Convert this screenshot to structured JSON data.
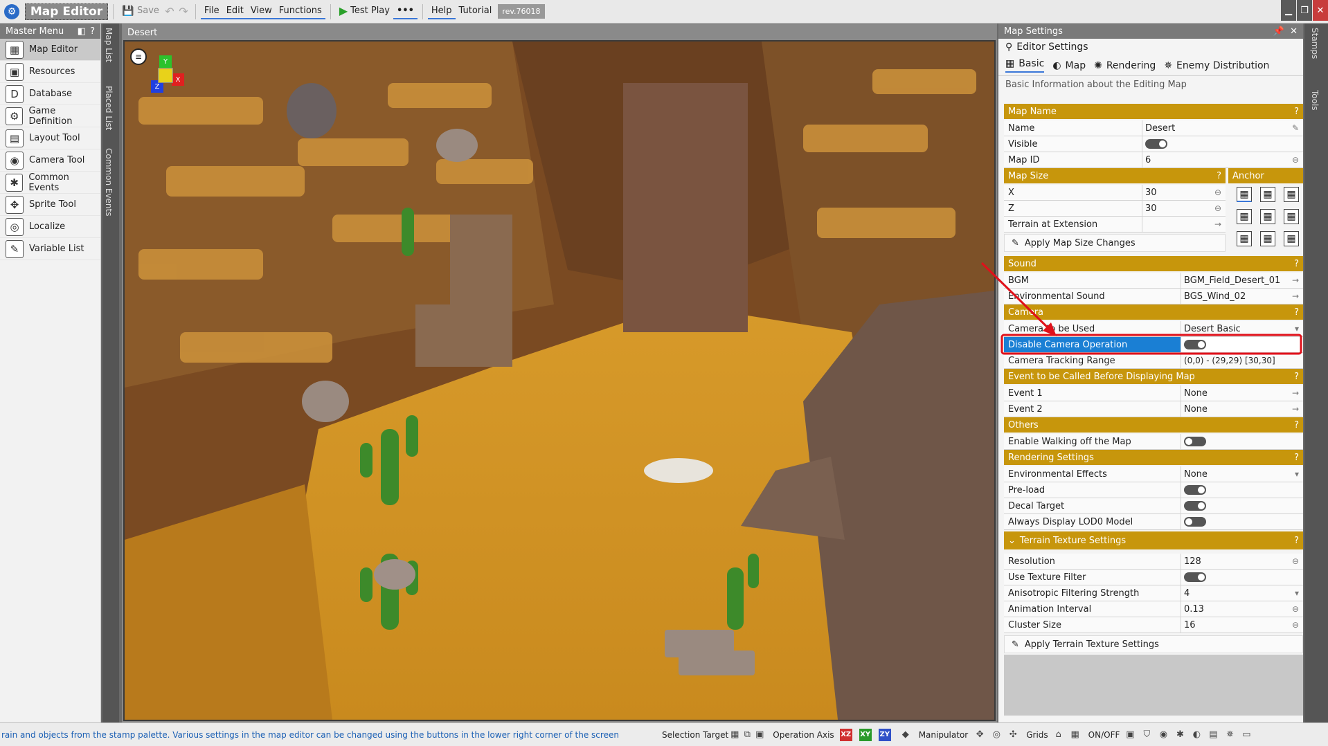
{
  "app": {
    "title": "Map Editor"
  },
  "toolbar": {
    "save": "Save",
    "menus": [
      "File",
      "Edit",
      "View",
      "Functions"
    ],
    "test_play": "Test Play",
    "more": "•••",
    "help": "Help",
    "tutorial": "Tutorial",
    "rev": "rev.76018"
  },
  "sidebar": {
    "title": "Master Menu",
    "help": "?",
    "items": [
      {
        "label": "Map Editor",
        "icon": "map-editor-icon"
      },
      {
        "label": "Resources",
        "icon": "resources-icon"
      },
      {
        "label": "Database",
        "icon": "database-icon"
      },
      {
        "label": "Game Definition",
        "icon": "game-definition-icon"
      },
      {
        "label": "Layout Tool",
        "icon": "layout-tool-icon"
      },
      {
        "label": "Camera Tool",
        "icon": "camera-tool-icon"
      },
      {
        "label": "Common Events",
        "icon": "common-events-icon"
      },
      {
        "label": "Sprite Tool",
        "icon": "sprite-tool-icon"
      },
      {
        "label": "Localize",
        "icon": "localize-icon"
      },
      {
        "label": "Variable List",
        "icon": "variable-list-icon"
      }
    ]
  },
  "vtabs": {
    "map_list": "Map List",
    "placed_list": "Placed List",
    "common_events": "Common Events"
  },
  "rtabs": {
    "stamps": "Stamps",
    "tools": "Tools"
  },
  "viewport": {
    "title": "Desert",
    "gizmo": {
      "y": "Y",
      "x": "X",
      "z": "Z"
    }
  },
  "panel": {
    "title": "Map Settings",
    "editor_settings": "Editor Settings",
    "tabs": [
      "Basic",
      "Map",
      "Rendering",
      "Enemy Distribution"
    ],
    "desc": "Basic Information about the Editing Map",
    "help": "?",
    "map_name": {
      "section": "Map Name",
      "name_label": "Name",
      "name_value": "Desert",
      "visible_label": "Visible",
      "mapid_label": "Map ID",
      "mapid_value": "6"
    },
    "map_size": {
      "section": "Map Size",
      "anchor": "Anchor",
      "x_label": "X",
      "x_value": "30",
      "z_label": "Z",
      "z_value": "30",
      "terrain_label": "Terrain at Extension",
      "apply": "Apply Map Size Changes"
    },
    "sound": {
      "section": "Sound",
      "bgm_label": "BGM",
      "bgm_value": "BGM_Field_Desert_01",
      "env_label": "Environmental Sound",
      "env_value": "BGS_Wind_02"
    },
    "camera": {
      "section": "Camera",
      "used_label": "Camera to be Used",
      "used_value": "Desert Basic",
      "disable_label": "Disable Camera Operation",
      "tracking_label": "Camera Tracking Range",
      "tracking_value": "(0,0) - (29,29) [30,30]"
    },
    "events": {
      "section": "Event to be Called Before Displaying Map",
      "e1_label": "Event 1",
      "e1_value": "None",
      "e2_label": "Event 2",
      "e2_value": "None"
    },
    "others": {
      "section": "Others",
      "walk_label": "Enable Walking off the Map"
    },
    "rendering": {
      "section": "Rendering Settings",
      "env_label": "Environmental Effects",
      "env_value": "None",
      "preload_label": "Pre-load",
      "decal_label": "Decal Target",
      "lod_label": "Always Display LOD0 Model"
    },
    "terrain_tex": {
      "section": "Terrain Texture Settings",
      "res_label": "Resolution",
      "res_value": "128",
      "filter_label": "Use Texture Filter",
      "aniso_label": "Anisotropic Filtering Strength",
      "aniso_value": "4",
      "anim_label": "Animation Interval",
      "anim_value": "0.13",
      "cluster_label": "Cluster Size",
      "cluster_value": "16",
      "apply": "Apply Terrain Texture Settings"
    }
  },
  "status": {
    "message": "rain and objects from the stamp palette.  Various settings in the map editor can be changed using the buttons in the lower right corner of the screen",
    "selection_target": "Selection Target",
    "operation_axis": "Operation Axis",
    "axes": [
      "XZ",
      "XY",
      "ZY"
    ],
    "manipulator": "Manipulator",
    "grids": "Grids",
    "onoff": "ON/OFF"
  },
  "colors": {
    "section": "#c7960c",
    "highlight": "#1a7fd4",
    "annotation": "#e0101a"
  }
}
